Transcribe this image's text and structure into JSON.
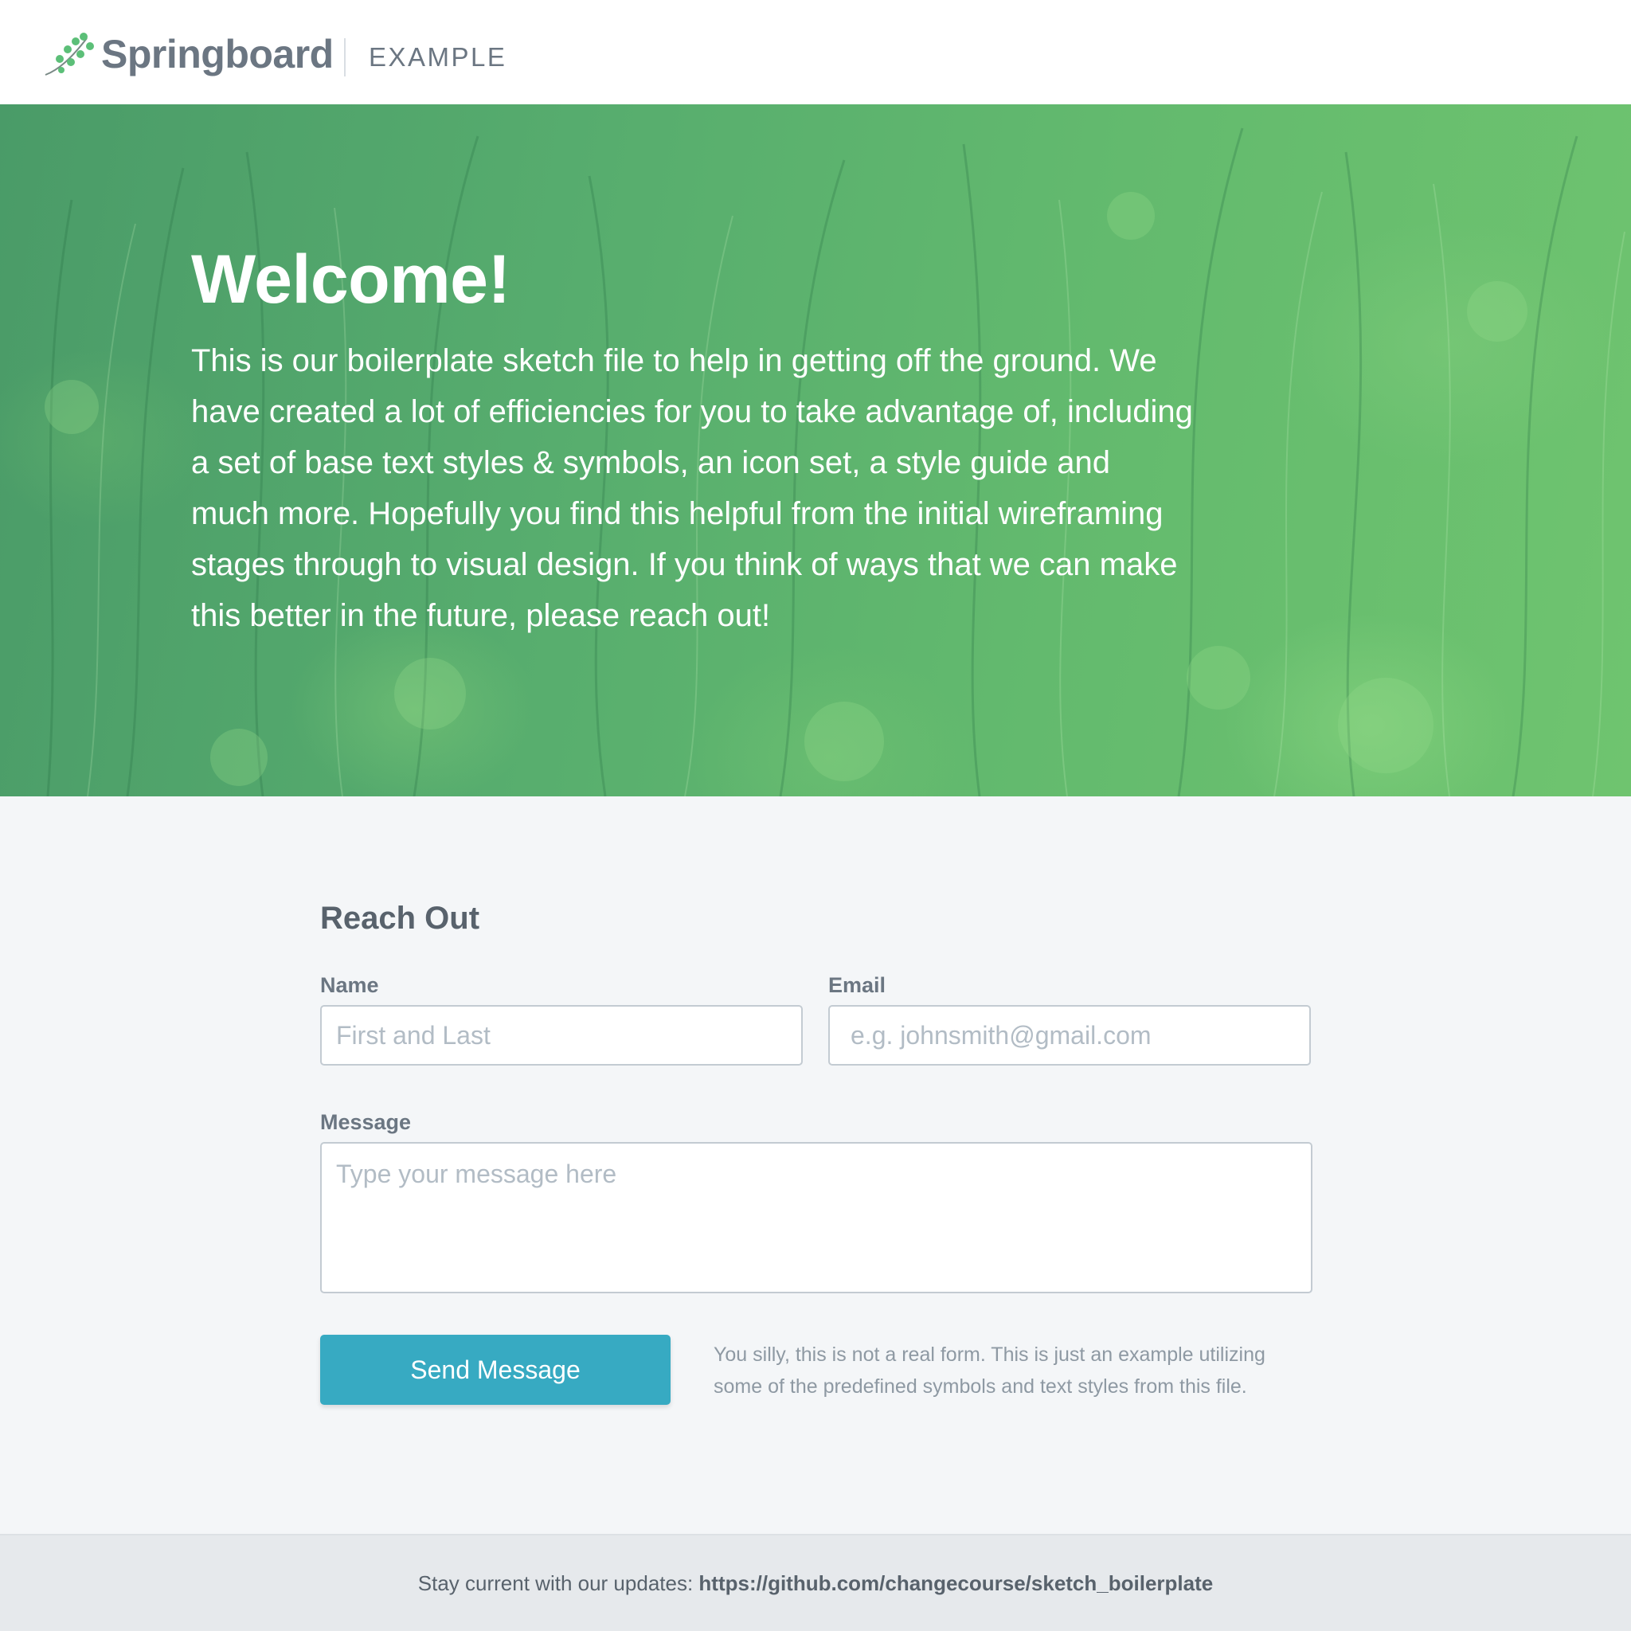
{
  "header": {
    "brand_name": "Springboard",
    "brand_tag": "EXAMPLE"
  },
  "hero": {
    "title": "Welcome!",
    "body": "This is our boilerplate sketch file to help in getting off the ground. We have created a lot of efficiencies for you to take advantage of, including a set of base text styles & symbols, an icon set, a style guide and much more. Hopefully you find this helpful from the initial wireframing stages through to visual design. If you think of ways that we can make this better in the future, please reach out!"
  },
  "form": {
    "title": "Reach Out",
    "name_label": "Name",
    "name_placeholder": "First and Last",
    "email_label": "Email",
    "email_placeholder": "e.g. johnsmith@gmail.com",
    "message_label": "Message",
    "message_placeholder": "Type your message here",
    "send_label": "Send Message",
    "note": "You silly, this is not a real form. This is just an example utilizing some of the predefined symbols and text styles from this file."
  },
  "footer": {
    "prefix": "Stay current with our updates:",
    "link": "https://github.com/changecourse/sketch_boilerplate"
  },
  "colors": {
    "brand_green": "#5cbf78",
    "button": "#37aac2",
    "hero_green": "#57ad6e",
    "text_gray": "#6b7682"
  },
  "icons": {
    "brand": "sprig-logo-icon"
  }
}
